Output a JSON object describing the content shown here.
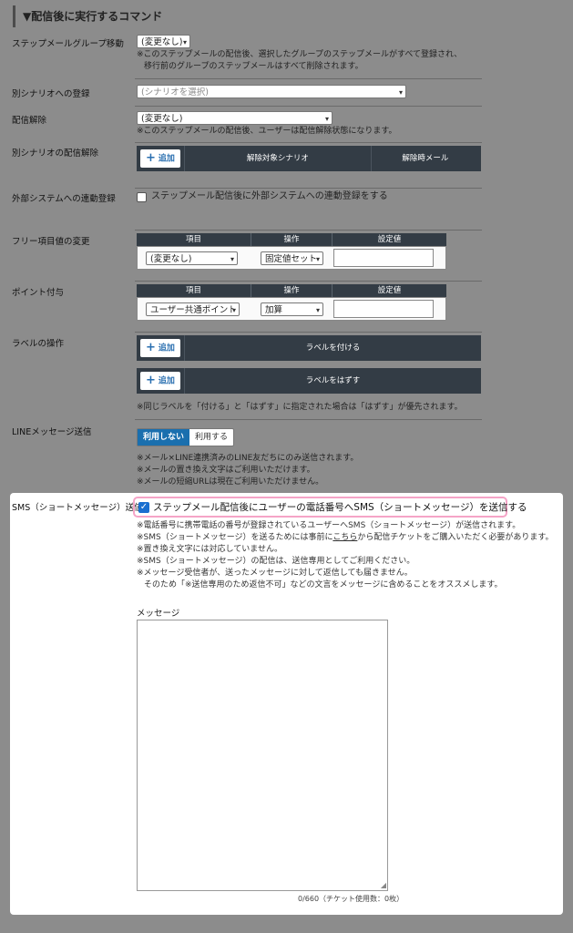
{
  "section_title": "▼配信後に実行するコマンド",
  "group_move": {
    "label": "ステップメールグループ移動",
    "select": "(変更なし)",
    "note1": "※このステップメールの配信後、選択したグループのステップメールがすべて登録され、",
    "note2": "移行前のグループのステップメールはすべて削除されます。"
  },
  "scenario_register": {
    "label": "別シナリオへの登録",
    "select": "(シナリオを選択)"
  },
  "unsubscribe": {
    "label": "配信解除",
    "select": "(変更なし)",
    "note": "※このステップメールの配信後、ユーザーは配信解除状態になります。"
  },
  "scenario_unsubscribe": {
    "label": "別シナリオの配信解除",
    "add": "追加",
    "col1": "解除対象シナリオ",
    "col2": "解除時メール"
  },
  "external": {
    "label": "外部システムへの連動登録",
    "checkbox": "ステップメール配信後に外部システムへの連動登録をする"
  },
  "free_item": {
    "label": "フリー項目値の変更",
    "h1": "項目",
    "h2": "操作",
    "h3": "設定値",
    "item": "(変更なし)",
    "op": "固定値セット"
  },
  "point": {
    "label": "ポイント付与",
    "h1": "項目",
    "h2": "操作",
    "h3": "設定値",
    "item": "ユーザー共通ポイント",
    "op": "加算"
  },
  "label_op": {
    "label": "ラベルの操作",
    "add": "追加",
    "attach": "ラベルを付ける",
    "detach": "ラベルをはずす",
    "note": "※同じラベルを「付ける」と「はずす」に指定された場合は「はずす」が優先されます。"
  },
  "line": {
    "label": "LINEメッセージ送信",
    "off": "利用しない",
    "on": "利用する",
    "note1": "※メール×LINE連携済みのLINE友だちにのみ送信されます。",
    "note2": "※メールの置き換え文字はご利用いただけます。",
    "note3": "※メールの短縮URLは現在ご利用いただけません。"
  },
  "sms": {
    "label": "SMS（ショートメッセージ）送信",
    "checkbox": "ステップメール配信後にユーザーの電話番号へSMS（ショートメッセージ）を送信する",
    "note1": "※電話番号に携帯電話の番号が登録されているユーザーへSMS（ショートメッセージ）が送信されます。",
    "note2a": "※SMS（ショートメッセージ）を送るためには事前に",
    "note2link": "こちら",
    "note2b": "から配信チケットをご購入いただく必要があります。",
    "note3": "※置き換え文字には対応していません。",
    "note4": "※SMS（ショートメッセージ）の配信は、送信専用としてご利用ください。",
    "note5": "※メッセージ受信者が、送ったメッセージに対して返信しても届きません。",
    "note6": "そのため「※送信専用のため返信不可」などの文言をメッセージに含めることをオススメします。",
    "message_label": "メッセージ",
    "counter": "0/660（チケット使用数：0枚）"
  }
}
